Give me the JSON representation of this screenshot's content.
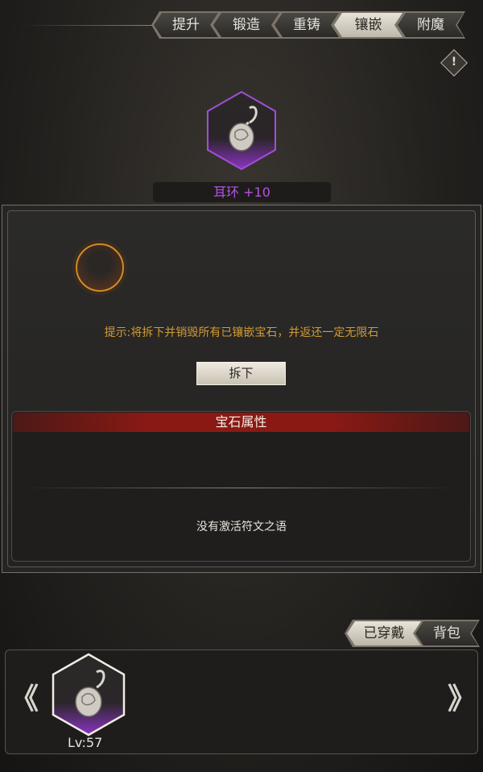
{
  "tabs": [
    {
      "label": "提升",
      "active": false
    },
    {
      "label": "锻造",
      "active": false
    },
    {
      "label": "重铸",
      "active": false
    },
    {
      "label": "镶嵌",
      "active": true
    },
    {
      "label": "附魔",
      "active": false
    }
  ],
  "warning_icon": "!",
  "item": {
    "name": "耳环 +10",
    "icon": "earring-icon",
    "rarity_color": "#9b3fd4"
  },
  "socket": {
    "icon": "empty-gem-socket-icon"
  },
  "hint_text": "提示:将拆下并销毁所有已镶嵌宝石，并返还一定无限石",
  "remove_button": "拆下",
  "gem_section": {
    "title": "宝石属性",
    "empty_text": "没有激活符文之语"
  },
  "bottom_tabs": [
    {
      "label": "已穿戴",
      "active": true
    },
    {
      "label": "背包",
      "active": false
    }
  ],
  "inventory": {
    "prev_arrow": "《",
    "next_arrow": "》",
    "items": [
      {
        "icon": "earring-icon",
        "level": "Lv:57"
      }
    ]
  },
  "colors": {
    "accent_gold": "#d19a36",
    "rarity_purple": "#b552e0",
    "header_red": "#8a1914"
  }
}
